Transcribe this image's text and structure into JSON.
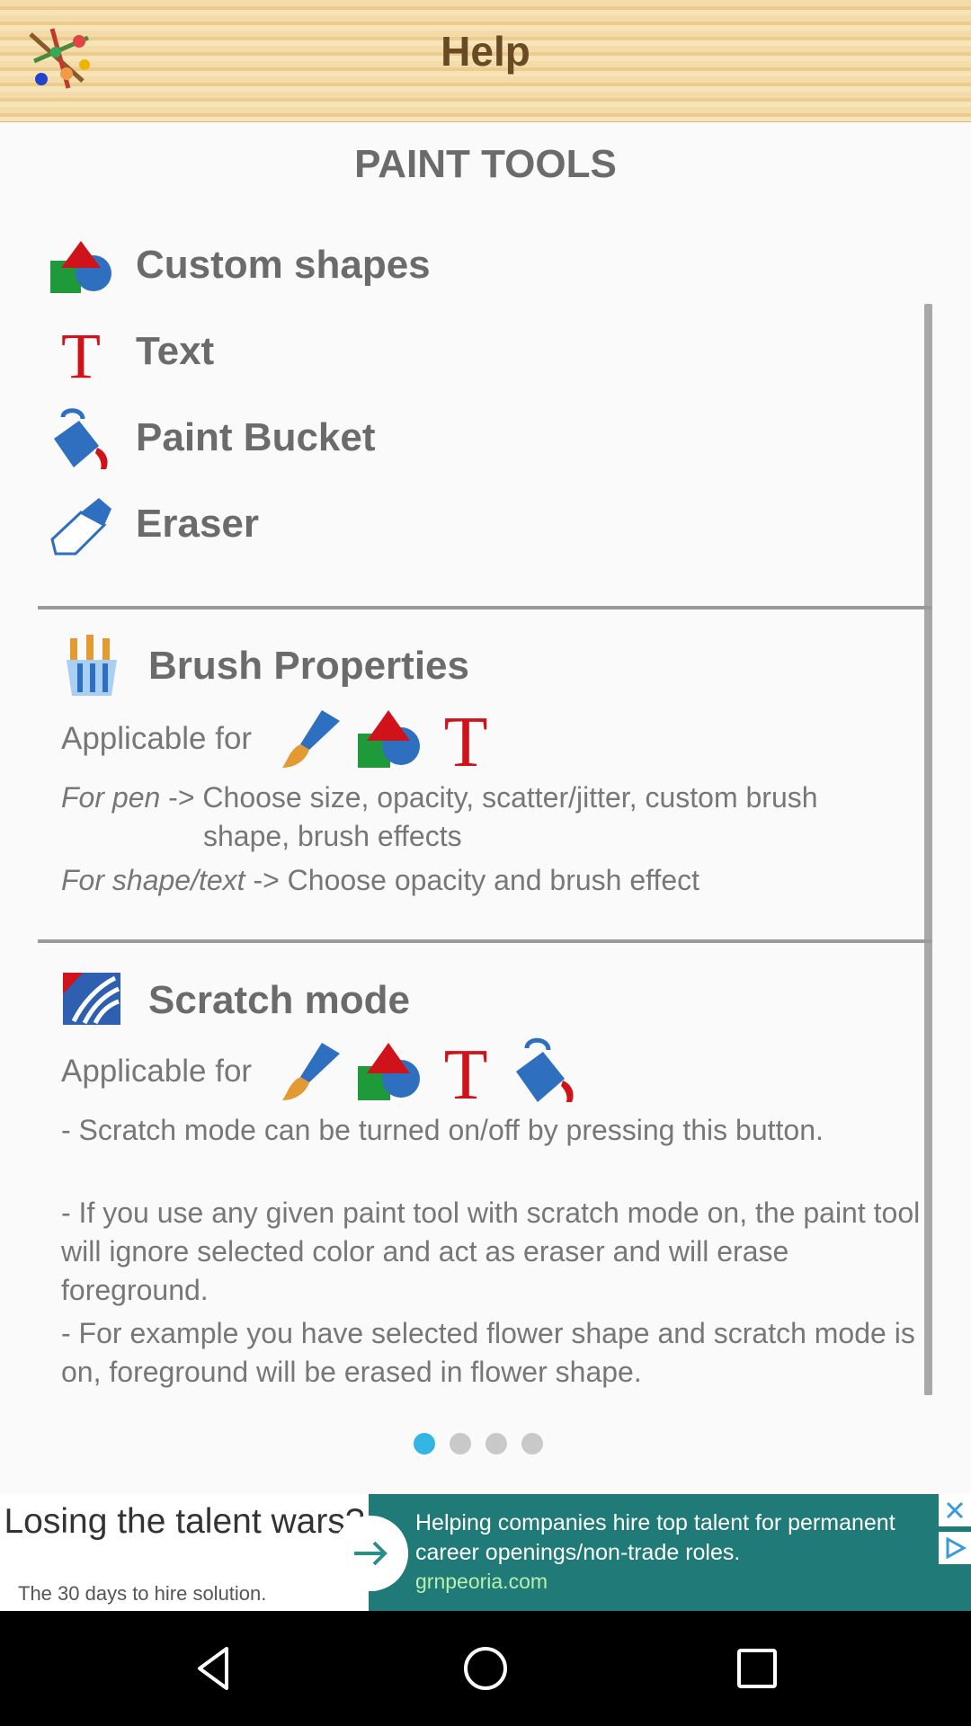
{
  "header": {
    "title": "Help"
  },
  "section_title": "PAINT TOOLS",
  "tools": [
    {
      "label": "Custom shapes",
      "icon": "shapes-icon"
    },
    {
      "label": "Text",
      "icon": "text-t-icon"
    },
    {
      "label": "Paint Bucket",
      "icon": "paint-bucket-icon"
    },
    {
      "label": "Eraser",
      "icon": "eraser-icon"
    }
  ],
  "brush": {
    "title": "Brush Properties",
    "applicable": "Applicable for",
    "desc1_italic": "For pen",
    "desc1_rest": " -> Choose size, opacity, scatter/jitter, custom brush",
    "desc1_cont": "shape, brush effects",
    "desc2_italic": "For shape/text",
    "desc2_rest": " -> Choose opacity and brush effect"
  },
  "scratch": {
    "title": "Scratch mode",
    "applicable": "Applicable for",
    "p1": "- Scratch mode can be turned on/off by pressing this button.",
    "p2": "- If you use any given paint tool with scratch mode on, the paint tool will ignore selected color and act as eraser and will erase foreground.",
    "p3": "- For example you have selected flower shape and scratch mode is on, foreground will be erased in flower shape."
  },
  "pager": {
    "pages": 4,
    "active": 1
  },
  "ad": {
    "headline": "Losing the talent wars?",
    "sub": "The 30 days to hire solution.",
    "text": "Helping companies hire top talent for permanent career openings/non-trade roles.",
    "domain": "grnpeoria.com"
  },
  "colors": {
    "accent": "#33b5e5",
    "header_text": "#6a4a24",
    "red": "#d0121b",
    "blue": "#2f6fc0",
    "green": "#1f9a3a"
  }
}
